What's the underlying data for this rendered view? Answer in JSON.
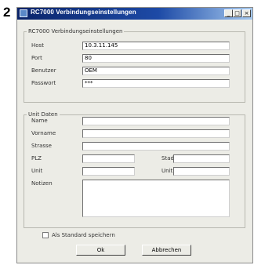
{
  "step_number": "2",
  "window": {
    "title": "RC7000 Verbindungseinstellungen",
    "controls": {
      "minimize": "_",
      "maximize": "□",
      "close": "×"
    }
  },
  "connection": {
    "legend": "RC7000 Verbindungseinstellungen",
    "host_label": "Host",
    "host_value": "10.3.11.145",
    "port_label": "Port",
    "port_value": "80",
    "user_label": "Benutzer",
    "user_value": "OEM",
    "password_label": "Passwort",
    "password_value": "***"
  },
  "unit": {
    "legend": "Unit Daten",
    "name_label": "Name",
    "name_value": "",
    "vorname_label": "Vorname",
    "vorname_value": "",
    "strasse_label": "Strasse",
    "strasse_value": "",
    "plz_label": "PLZ",
    "plz_value": "",
    "stadt_label": "Stadt",
    "stadt_value": "",
    "unit_label": "Unit",
    "unit_value": "",
    "unitnr_label": "Unit Nr",
    "unitnr_value": "",
    "notizen_label": "Notizen",
    "notizen_value": ""
  },
  "footer": {
    "default_label": "Als Standard speichern",
    "ok_label": "Ok",
    "cancel_label": "Abbrechen"
  }
}
